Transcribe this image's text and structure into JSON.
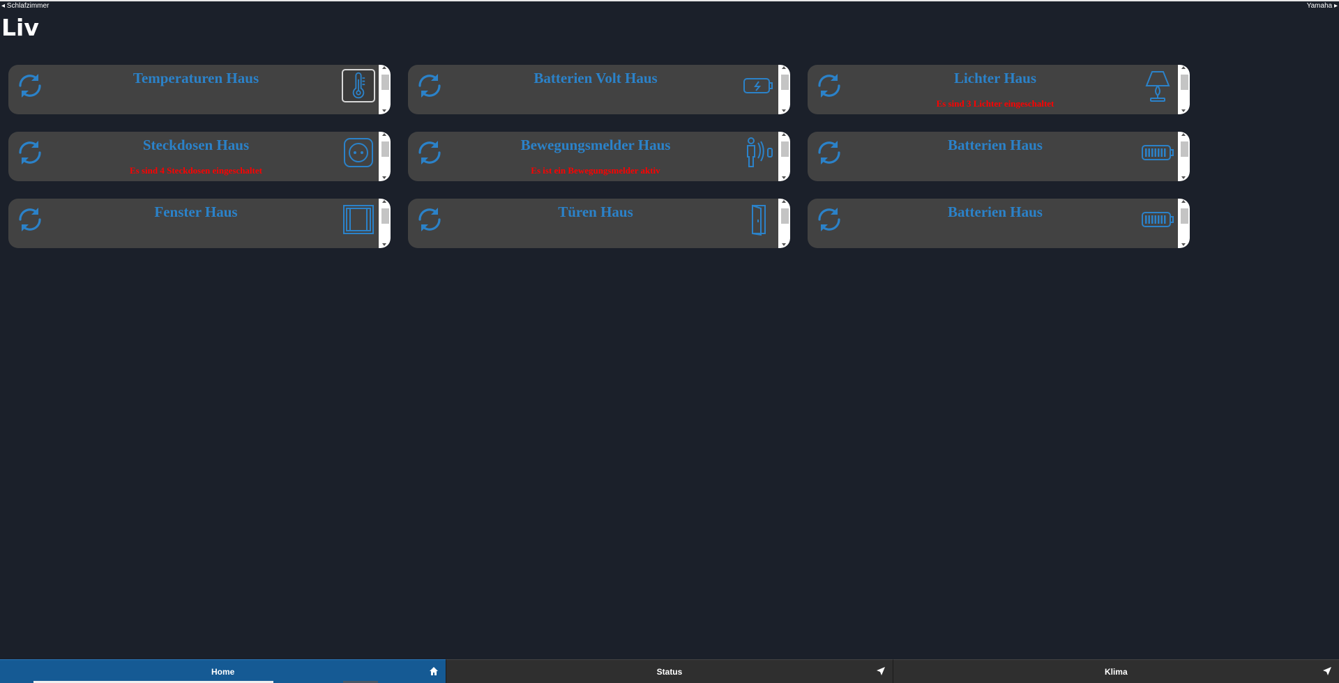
{
  "nav": {
    "prev_label": "◂ Schlafzimmer",
    "next_label": "Yamaha ▸"
  },
  "page": {
    "title": "Liv"
  },
  "tiles": [
    {
      "title": "Temperaturen Haus",
      "message": "",
      "icon": "thermometer-icon"
    },
    {
      "title": "Batterien Volt Haus",
      "message": "",
      "icon": "battery-charging-icon"
    },
    {
      "title": "Lichter Haus",
      "message": "Es sind 3 Lichter eingeschaltet",
      "icon": "lamp-icon"
    },
    {
      "title": "Steckdosen Haus",
      "message": "Es sind 4 Steckdosen eingeschaltet",
      "icon": "power-socket-icon"
    },
    {
      "title": "Bewegungsmelder Haus",
      "message": "Es ist ein Bewegungsmelder aktiv",
      "icon": "motion-sensor-icon"
    },
    {
      "title": "Batterien Haus",
      "message": "",
      "icon": "battery-full-icon"
    },
    {
      "title": "Fenster Haus",
      "message": "",
      "icon": "window-icon"
    },
    {
      "title": "Türen Haus",
      "message": "",
      "icon": "door-icon"
    },
    {
      "title": "Batterien Haus",
      "message": "",
      "icon": "battery-full-icon"
    }
  ],
  "footer": {
    "tabs": [
      {
        "label": "Home",
        "icon": "home-icon",
        "active": true
      },
      {
        "label": "Status",
        "icon": "location-arrow-icon",
        "active": false
      },
      {
        "label": "Klima",
        "icon": "location-arrow-icon",
        "active": false
      }
    ]
  },
  "colors": {
    "background": "#1b202a",
    "tile": "#424242",
    "accent": "#2b82c9",
    "alert": "#ff0000",
    "active_tab": "#155a94"
  }
}
